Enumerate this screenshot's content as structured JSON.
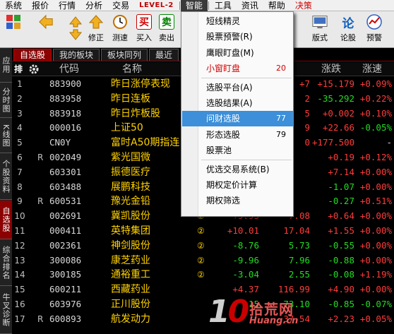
{
  "menubar": {
    "items": [
      "系统",
      "报价",
      "行情",
      "分析",
      "交易",
      "LEVEL-2",
      "智能",
      "工具",
      "资讯",
      "帮助",
      "决策"
    ]
  },
  "toolbar": {
    "labels": [
      "",
      "",
      "修正",
      "测速",
      "买入",
      "卖出",
      "版式",
      "论股",
      "预警"
    ]
  },
  "sidebar": {
    "tabs": [
      "应用",
      "分时图",
      "K线图",
      "个股资料",
      "自选股",
      "综合排名",
      "牛叉诊断"
    ]
  },
  "block_tabs": [
    "自选股",
    "我的板块",
    "板块同列",
    "最近"
  ],
  "table": {
    "headers": {
      "code": "代码",
      "name": "名称",
      "change_pct": "涨跌",
      "speed": "涨速"
    },
    "rows": [
      {
        "idx": "1",
        "flag": "",
        "code": "883900",
        "name": "昨日涨停表现",
        "mark": "",
        "pct": "",
        "price": "+7",
        "chg": "+15.179",
        "spd": "+0.09%",
        "pc": "up",
        "cc": "up",
        "sc": "up"
      },
      {
        "idx": "2",
        "flag": "",
        "code": "883958",
        "name": "昨日连板",
        "mark": "",
        "pct": "",
        "price": "2",
        "chg": "-35.292",
        "spd": "+0.22%",
        "pc": "up",
        "cc": "dn",
        "sc": "up"
      },
      {
        "idx": "3",
        "flag": "",
        "code": "883918",
        "name": "昨日炸板股",
        "mark": "",
        "pct": "",
        "price": "5",
        "chg": "+0.002",
        "spd": "+0.10%",
        "pc": "up",
        "cc": "up",
        "sc": "up"
      },
      {
        "idx": "4",
        "flag": "",
        "code": "000016",
        "name": "上证50",
        "mark": "",
        "pct": "",
        "price": "9",
        "chg": "+22.66",
        "spd": "-0.05%",
        "pc": "up",
        "cc": "up",
        "sc": "dn"
      },
      {
        "idx": "5",
        "flag": "",
        "code": "CN0Y",
        "name": "富时A50期指连",
        "mark": "",
        "pct": "",
        "price": "0",
        "chg": "+177.500",
        "spd": "-",
        "pc": "up",
        "cc": "up",
        "sc": "nt"
      },
      {
        "idx": "6",
        "flag": "R",
        "code": "002049",
        "name": "紫光国微",
        "mark": "",
        "pct": "",
        "price": "",
        "chg": "+0.19",
        "spd": "+0.12%",
        "pc": "up",
        "cc": "up",
        "sc": "up"
      },
      {
        "idx": "7",
        "flag": "",
        "code": "603301",
        "name": "振德医疗",
        "mark": "",
        "pct": "",
        "price": "",
        "chg": "+7.14",
        "spd": "+0.00%",
        "pc": "up",
        "cc": "up",
        "sc": "up"
      },
      {
        "idx": "8",
        "flag": "",
        "code": "603488",
        "name": "展鹏科技",
        "mark": "",
        "pct": "",
        "price": "",
        "chg": "-1.07",
        "spd": "+0.00%",
        "pc": "dn",
        "cc": "dn",
        "sc": "up"
      },
      {
        "idx": "9",
        "flag": "R",
        "code": "600531",
        "name": "豫光金铅",
        "mark": "",
        "pct": "",
        "price": "",
        "chg": "-0.27",
        "spd": "+0.51%",
        "pc": "dn",
        "cc": "dn",
        "sc": "up"
      },
      {
        "idx": "10",
        "flag": "",
        "code": "002691",
        "name": "冀凯股份",
        "mark": "②",
        "pct": "+9.93",
        "price": "7.08",
        "chg": "+0.64",
        "spd": "+0.00%",
        "pc": "up",
        "cc": "up",
        "sc": "up"
      },
      {
        "idx": "11",
        "flag": "",
        "code": "000411",
        "name": "英特集团",
        "mark": "②",
        "pct": "+10.01",
        "price": "17.04",
        "chg": "+1.55",
        "spd": "+0.00%",
        "pc": "up",
        "cc": "up",
        "sc": "up"
      },
      {
        "idx": "12",
        "flag": "",
        "code": "002361",
        "name": "神剑股份",
        "mark": "②",
        "pct": "-8.76",
        "price": "5.73",
        "chg": "-0.55",
        "spd": "+0.00%",
        "pc": "dn",
        "cc": "dn",
        "sc": "up"
      },
      {
        "idx": "13",
        "flag": "",
        "code": "300086",
        "name": "康芝药业",
        "mark": "②",
        "pct": "-9.96",
        "price": "7.96",
        "chg": "-0.88",
        "spd": "+0.00%",
        "pc": "dn",
        "cc": "dn",
        "sc": "up"
      },
      {
        "idx": "14",
        "flag": "",
        "code": "300185",
        "name": "通裕重工",
        "mark": "②",
        "pct": "-3.04",
        "price": "2.55",
        "chg": "-0.08",
        "spd": "+1.19%",
        "pc": "dn",
        "cc": "dn",
        "sc": "up"
      },
      {
        "idx": "15",
        "flag": "",
        "code": "600211",
        "name": "西藏药业",
        "mark": "",
        "pct": "+4.37",
        "price": "116.99",
        "chg": "+4.90",
        "spd": "+0.00%",
        "pc": "up",
        "cc": "up",
        "sc": "up"
      },
      {
        "idx": "16",
        "flag": "",
        "code": "603976",
        "name": "正川股份",
        "mark": "",
        "pct": "15",
        "price": "73.10",
        "chg": "-0.85",
        "spd": "-0.07%",
        "pc": "dn",
        "cc": "dn",
        "sc": "dn"
      },
      {
        "idx": "17",
        "flag": "R",
        "code": "600893",
        "name": "航发动力",
        "mark": "",
        "pct": "",
        "price": "37.54",
        "chg": "+2.23",
        "spd": "+0.05%",
        "pc": "up",
        "cc": "up",
        "sc": "up"
      }
    ]
  },
  "dropdown": {
    "items": [
      {
        "label": "短线精灵",
        "badge": "",
        "style": ""
      },
      {
        "label": "股票预警(R)",
        "badge": "",
        "style": ""
      },
      {
        "label": "鹰眼盯盘(M)",
        "badge": "",
        "style": ""
      },
      {
        "label": "小窗盯盘",
        "badge": "20",
        "style": "red"
      },
      {
        "label": "选股平台(A)",
        "badge": "",
        "style": ""
      },
      {
        "label": "选股结果(A)",
        "badge": "",
        "style": ""
      },
      {
        "label": "问财选股",
        "badge": "77",
        "style": "hl"
      },
      {
        "label": "形态选股",
        "badge": "79",
        "style": ""
      },
      {
        "label": "股票池",
        "badge": "",
        "style": ""
      },
      {
        "label": "优选交易系统(B)",
        "badge": "",
        "style": ""
      },
      {
        "label": "期权定价计算",
        "badge": "",
        "style": ""
      },
      {
        "label": "期权筛选",
        "badge": "",
        "style": ""
      }
    ]
  },
  "watermark": {
    "cn": "拾荒网",
    "domain": "Huang.cn"
  },
  "colors": {
    "up": "#ff3b3b",
    "down": "#22dd22",
    "name": "#ffd200",
    "accent": "#8b0000",
    "highlight": "#3c8fd8"
  }
}
